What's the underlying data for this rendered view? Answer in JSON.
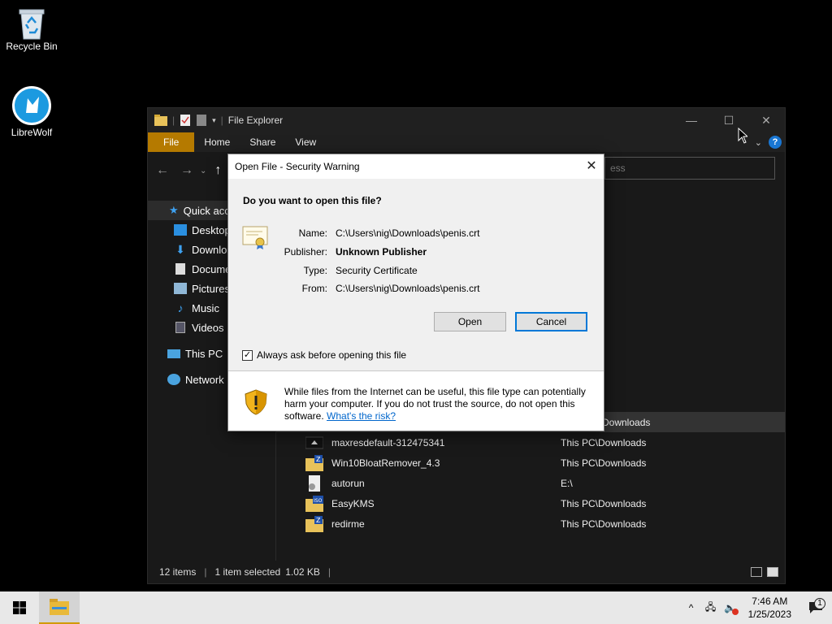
{
  "desktop": {
    "icons": [
      {
        "label": "Recycle Bin"
      },
      {
        "label": "LibreWolf"
      }
    ]
  },
  "explorer": {
    "title": "File Explorer",
    "tabs": {
      "file": "File",
      "home": "Home",
      "share": "Share",
      "view": "View"
    },
    "search_placeholder": "ess",
    "sidebar": {
      "quick_access": "Quick acc",
      "desktop": "Desktop",
      "downloads": "Downloa",
      "documents": "Docume",
      "pictures": "Pictures",
      "music": "Music",
      "videos": "Videos",
      "this_pc": "This PC",
      "network": "Network"
    },
    "files": [
      {
        "name": "",
        "location": "Downloads"
      },
      {
        "name": "maxresdefault-312475341",
        "location": "This PC\\Downloads"
      },
      {
        "name": "Win10BloatRemover_4.3",
        "location": "This PC\\Downloads"
      },
      {
        "name": "autorun",
        "location": "E:\\"
      },
      {
        "name": "EasyKMS",
        "location": "This PC\\Downloads"
      },
      {
        "name": "redirme",
        "location": "This PC\\Downloads"
      }
    ],
    "status": {
      "items": "12 items",
      "selected": "1 item selected",
      "size": "1.02 KB"
    }
  },
  "dialog": {
    "title": "Open File - Security Warning",
    "question": "Do you want to open this file?",
    "labels": {
      "name": "Name:",
      "publisher": "Publisher:",
      "type": "Type:",
      "from": "From:"
    },
    "values": {
      "name": "C:\\Users\\nig\\Downloads\\penis.crt",
      "publisher": "Unknown Publisher",
      "type": "Security Certificate",
      "from": "C:\\Users\\nig\\Downloads\\penis.crt"
    },
    "open_label": "Open",
    "cancel_label": "Cancel",
    "checkbox_label": "Always ask before opening this file",
    "checkbox_checked": true,
    "warning_text": "While files from the Internet can be useful, this file type can potentially harm your computer. If you do not trust the source, do not open this software.",
    "warning_link": "What's the risk?"
  },
  "taskbar": {
    "time": "7:46 AM",
    "date": "1/25/2023",
    "notification_count": "1"
  },
  "colors": {
    "file_tab": "#b57a00",
    "accent": "#0078d7",
    "folder": "#e8c25a"
  }
}
